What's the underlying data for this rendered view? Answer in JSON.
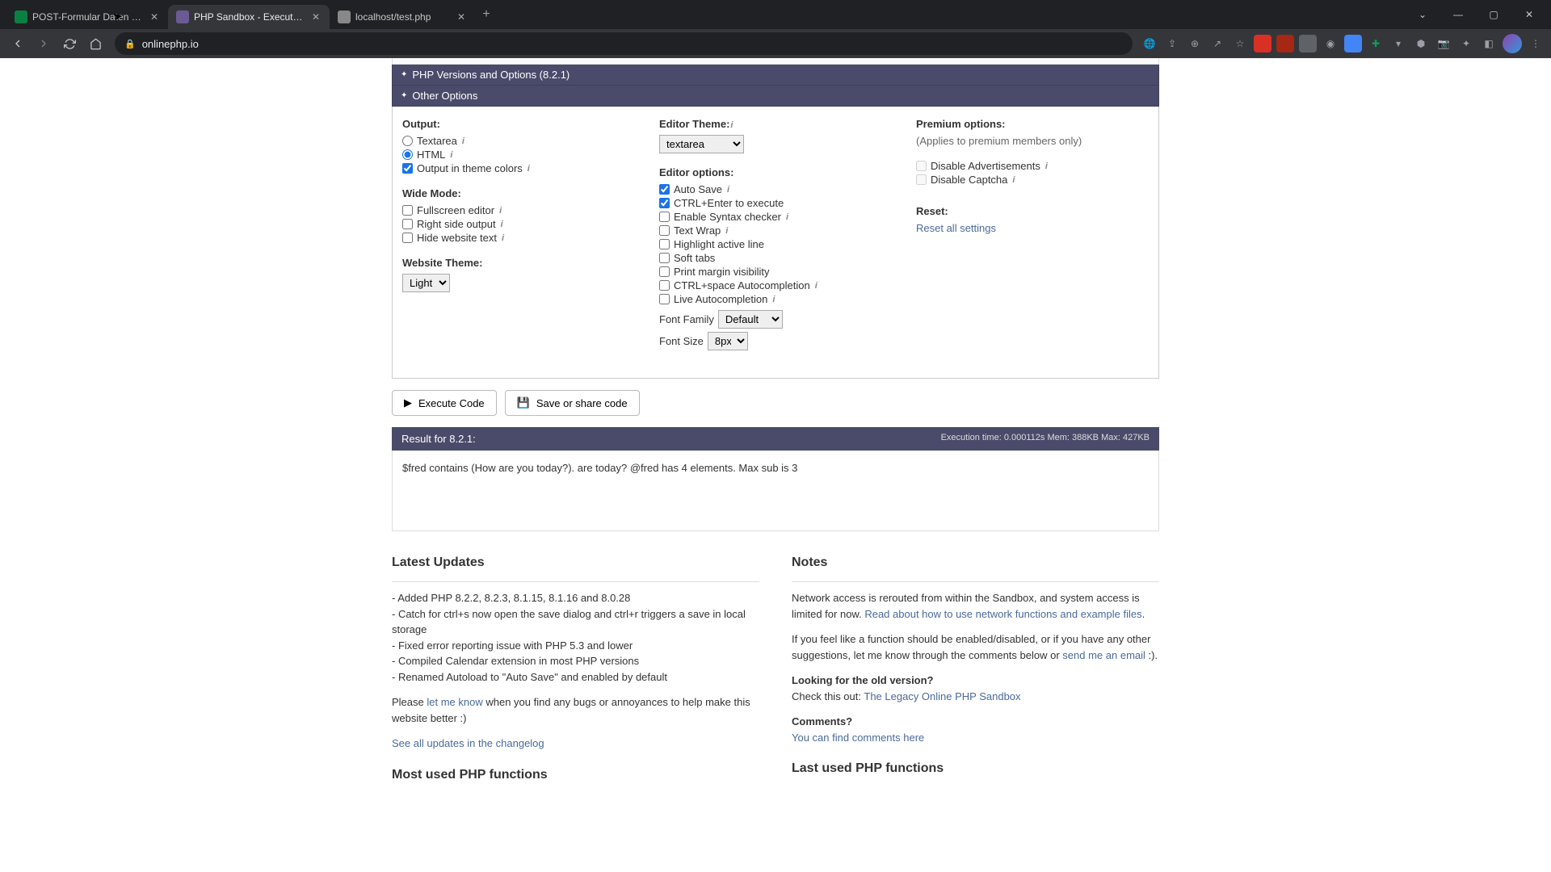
{
  "browser": {
    "tabs": [
      {
        "title": "POST-Formular Daten ve...beite",
        "favicon": "#0b8043"
      },
      {
        "title": "PHP Sandbox - Execute PHP cod",
        "favicon": "#6b5b95"
      },
      {
        "title": "localhost/test.php",
        "favicon": "#888"
      }
    ],
    "url": "onlinephp.io"
  },
  "panels": {
    "versions_title": "PHP Versions and Options (8.2.1)",
    "other_title": "Other Options"
  },
  "output": {
    "heading": "Output:",
    "textarea": "Textarea",
    "html": "HTML",
    "theme_colors": "Output in theme colors"
  },
  "wide_mode": {
    "heading": "Wide Mode:",
    "fullscreen": "Fullscreen editor",
    "right_side": "Right side output",
    "hide_text": "Hide website text"
  },
  "website_theme": {
    "heading": "Website Theme:",
    "value": "Light"
  },
  "editor_theme": {
    "heading": "Editor Theme:",
    "value": "textarea"
  },
  "editor_options": {
    "heading": "Editor options:",
    "auto_save": "Auto Save",
    "ctrl_enter": "CTRL+Enter to execute",
    "syntax": "Enable Syntax checker",
    "text_wrap": "Text Wrap",
    "highlight": "Highlight active line",
    "soft_tabs": "Soft tabs",
    "print_margin": "Print margin visibility",
    "ctrl_space": "CTRL+space Autocompletion",
    "live_auto": "Live Autocompletion",
    "font_family_label": "Font Family",
    "font_family_value": "Default",
    "font_size_label": "Font Size",
    "font_size_value": "8px"
  },
  "premium": {
    "heading": "Premium options:",
    "sub": "(Applies to premium members only)",
    "disable_ads": "Disable Advertisements",
    "disable_captcha": "Disable Captcha"
  },
  "reset": {
    "heading": "Reset:",
    "link": "Reset all settings"
  },
  "actions": {
    "execute": "Execute Code",
    "save": "Save or share code"
  },
  "result": {
    "title": "Result for 8.2.1:",
    "meta": "Execution time: 0.000112s Mem: 388KB Max: 427KB",
    "body": "$fred contains (How are you today?). are today? @fred has 4 elements. Max sub is 3"
  },
  "latest_updates": {
    "heading": "Latest Updates",
    "l1": "- Added PHP 8.2.2, 8.2.3, 8.1.15, 8.1.16 and 8.0.28",
    "l2": "- Catch for ctrl+s now open the save dialog and ctrl+r triggers a save in local storage",
    "l3": "- Fixed error reporting issue with PHP 5.3 and lower",
    "l4": "- Compiled Calendar extension in most PHP versions",
    "l5": "- Renamed Autoload to \"Auto Save\" and enabled by default",
    "p2a": "Please ",
    "p2_link": "let me know",
    "p2b": " when you find any bugs or annoyances to help make this website better :)",
    "p3": "See all updates in the changelog"
  },
  "notes": {
    "heading": "Notes",
    "p1a": "Network access is rerouted from within the Sandbox, and system access is limited for now. ",
    "p1_link": "Read about how to use network functions and example files",
    "p1b": ".",
    "p2a": "If you feel like a function should be enabled/disabled, or if you have any other suggestions, let me know through the comments below or ",
    "p2_link": "send me an email",
    "p2b": " :).",
    "old_heading": "Looking for the old version?",
    "old_a": "Check this out: ",
    "old_link": "The Legacy Online PHP Sandbox",
    "comments_heading": "Comments?",
    "comments_link": "You can find comments here"
  },
  "bottom": {
    "most_used": "Most used PHP functions",
    "last_used": "Last used PHP functions"
  }
}
